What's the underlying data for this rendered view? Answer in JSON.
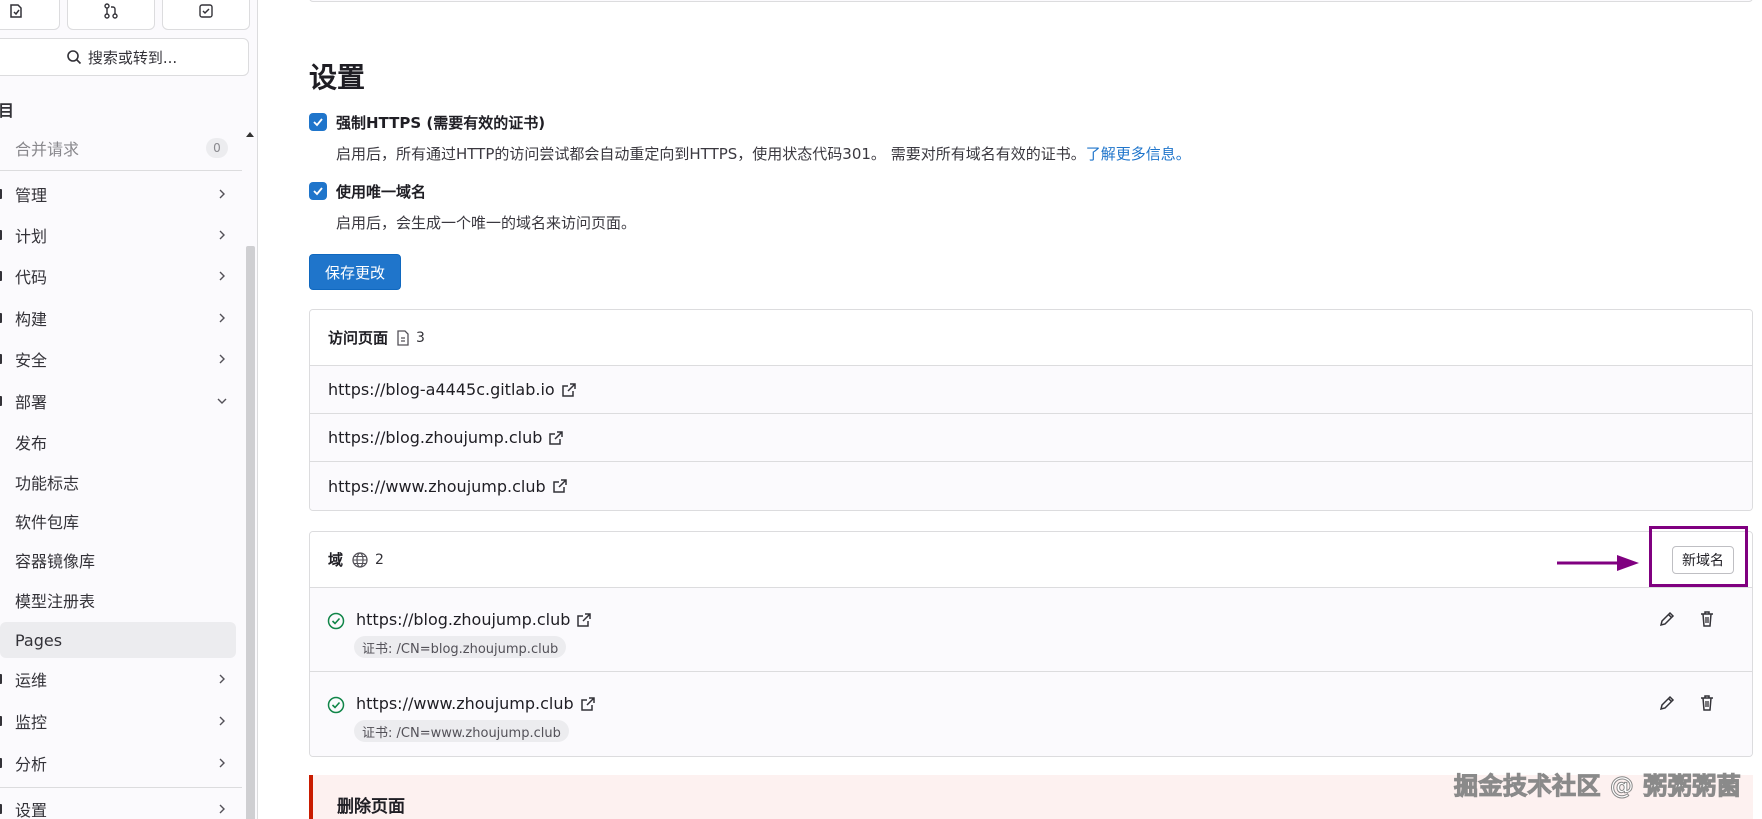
{
  "sidebar": {
    "search_label": "搜索或转到...",
    "project_mark": "目",
    "merge_requests": {
      "label": "合并请求",
      "count": "0"
    },
    "items": [
      {
        "label": "管理"
      },
      {
        "label": "计划"
      },
      {
        "label": "代码"
      },
      {
        "label": "构建"
      },
      {
        "label": "安全"
      },
      {
        "label": "部署"
      },
      {
        "label": "发布"
      },
      {
        "label": "功能标志"
      },
      {
        "label": "软件包库"
      },
      {
        "label": "容器镜像库"
      },
      {
        "label": "模型注册表"
      },
      {
        "label": "Pages"
      },
      {
        "label": "运维"
      },
      {
        "label": "监控"
      },
      {
        "label": "分析"
      },
      {
        "label": "设置"
      }
    ]
  },
  "settings": {
    "title": "设置",
    "force_https": {
      "label": "强制HTTPS (需要有效的证书)",
      "help": "启用后，所有通过HTTP的访问尝试都会自动重定向到HTTPS，使用状态代码301。 需要对所有域名有效的证书。",
      "link": "了解更多信息。"
    },
    "unique_domain": {
      "label": "使用唯一域名",
      "help": "启用后，会生成一个唯一的域名来访问页面。"
    },
    "save_label": "保存更改"
  },
  "access_pages": {
    "title": "访问页面",
    "count": "3",
    "urls": [
      "https://blog-a4445c.gitlab.io",
      "https://blog.zhoujump.club",
      "https://www.zhoujump.club"
    ]
  },
  "domains": {
    "title": "域",
    "count": "2",
    "new_label": "新域名",
    "items": [
      {
        "url": "https://blog.zhoujump.club",
        "cert": "证书: /CN=blog.zhoujump.club"
      },
      {
        "url": "https://www.zhoujump.club",
        "cert": "证书: /CN=www.zhoujump.club"
      }
    ]
  },
  "danger": {
    "title": "删除页面"
  },
  "watermark": "掘金技术社区 @ 粥粥粥菌",
  "colors": {
    "primary": "#1f75cb",
    "annotation": "#800080",
    "success": "#108548",
    "danger_border": "#c91c00"
  }
}
